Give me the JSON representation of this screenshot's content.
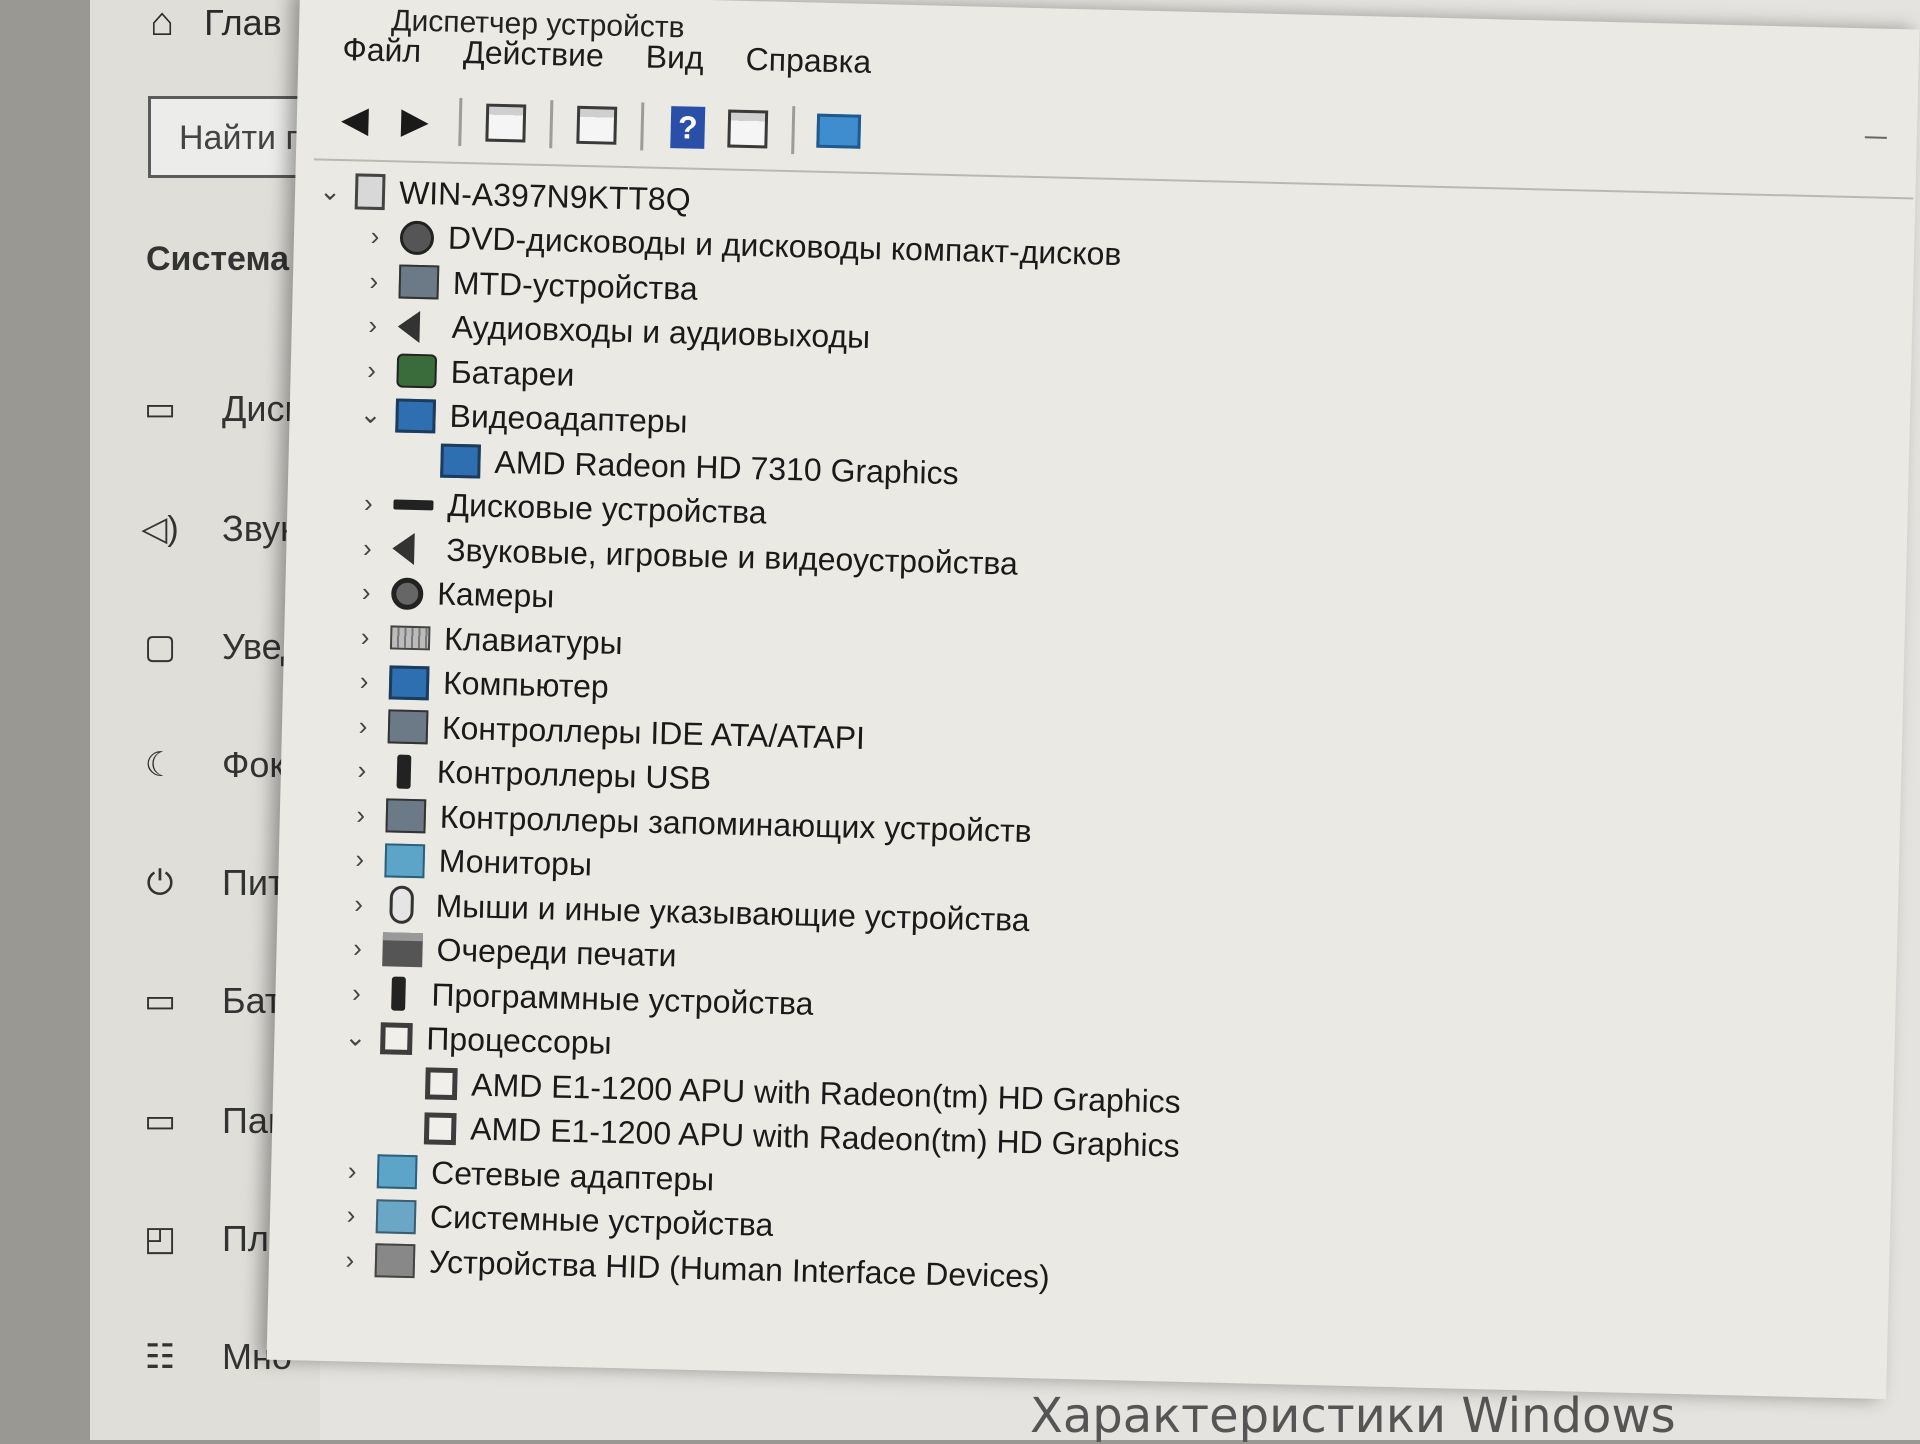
{
  "settings": {
    "home_label": "Глав",
    "search_placeholder": "Найти п",
    "section_title": "Система",
    "nav": [
      {
        "icon": "display-icon",
        "glyph": "▭",
        "label": "Дисп"
      },
      {
        "icon": "sound-icon",
        "glyph": "◁)",
        "label": "Звук"
      },
      {
        "icon": "notifications-icon",
        "glyph": "▢",
        "label": "Увед"
      },
      {
        "icon": "focus-icon",
        "glyph": "☾",
        "label": "Фоку"
      },
      {
        "icon": "power-icon",
        "glyph": "⏻",
        "label": "Пита"
      },
      {
        "icon": "battery-icon",
        "glyph": "▭",
        "label": "Батар"
      },
      {
        "icon": "storage-icon",
        "glyph": "▭",
        "label": "Памя"
      },
      {
        "icon": "tablet-icon",
        "glyph": "◰",
        "label": "План"
      },
      {
        "icon": "multitasking-icon",
        "glyph": "☷",
        "label": "Мно"
      }
    ],
    "footer_text": "Характеристики Windows"
  },
  "device_manager": {
    "title": "Диспетчер устройств",
    "menu": [
      "Файл",
      "Действие",
      "Вид",
      "Справка"
    ],
    "computer_name": "WIN-A397N9KTT8Q",
    "categories": [
      {
        "label": "DVD-дисководы и дисководы компакт-дисков",
        "icon": "dvd-icon",
        "expanded": false
      },
      {
        "label": "MTD-устройства",
        "icon": "mtd-icon",
        "expanded": false
      },
      {
        "label": "Аудиовходы и аудиовыходы",
        "icon": "speaker-icon",
        "expanded": false
      },
      {
        "label": "Батареи",
        "icon": "battery-icon",
        "expanded": false
      },
      {
        "label": "Видеоадаптеры",
        "icon": "display-adapter-icon",
        "expanded": true,
        "children": [
          "AMD Radeon HD 7310 Graphics"
        ]
      },
      {
        "label": "Дисковые устройства",
        "icon": "disk-drive-icon",
        "expanded": false
      },
      {
        "label": "Звуковые, игровые и видеоустройства",
        "icon": "speaker-icon",
        "expanded": false
      },
      {
        "label": "Камеры",
        "icon": "camera-icon",
        "expanded": false
      },
      {
        "label": "Клавиатуры",
        "icon": "keyboard-icon",
        "expanded": false
      },
      {
        "label": "Компьютер",
        "icon": "computer-icon",
        "expanded": false
      },
      {
        "label": "Контроллеры IDE ATA/ATAPI",
        "icon": "ide-controller-icon",
        "expanded": false
      },
      {
        "label": "Контроллеры USB",
        "icon": "usb-icon",
        "expanded": false
      },
      {
        "label": "Контроллеры запоминающих устройств",
        "icon": "storage-controller-icon",
        "expanded": false
      },
      {
        "label": "Мониторы",
        "icon": "monitor-icon",
        "expanded": false
      },
      {
        "label": "Мыши и иные указывающие устройства",
        "icon": "mouse-icon",
        "expanded": false
      },
      {
        "label": "Очереди печати",
        "icon": "printer-icon",
        "expanded": false
      },
      {
        "label": "Программные устройства",
        "icon": "software-device-icon",
        "expanded": false
      },
      {
        "label": "Процессоры",
        "icon": "processor-icon",
        "expanded": true,
        "children": [
          "AMD E1-1200 APU with Radeon(tm) HD Graphics",
          "AMD E1-1200 APU with Radeon(tm) HD Graphics"
        ]
      },
      {
        "label": "Сетевые адаптеры",
        "icon": "network-adapter-icon",
        "expanded": false
      },
      {
        "label": "Системные устройства",
        "icon": "system-device-icon",
        "expanded": false
      },
      {
        "label": "Устройства HID (Human Interface Devices)",
        "icon": "hid-icon",
        "expanded": false
      }
    ]
  }
}
